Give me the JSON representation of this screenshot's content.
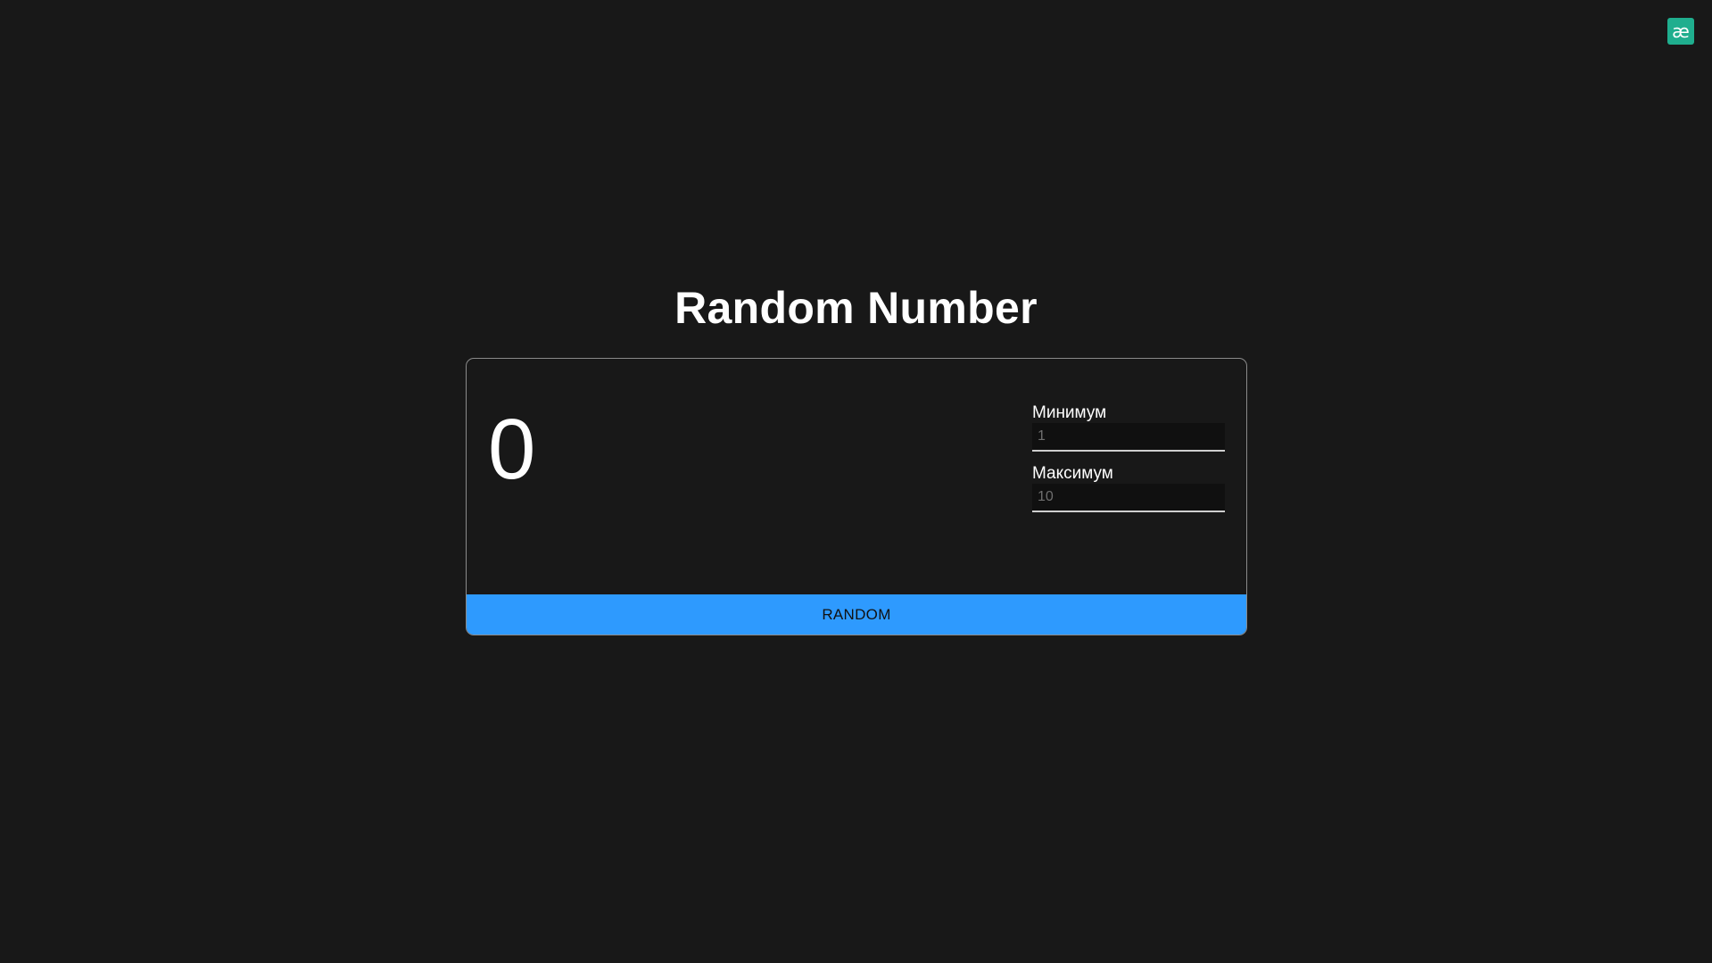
{
  "corner_badge": {
    "glyph": "æ",
    "icon": "ae-logo-icon",
    "color": "#1fae8e"
  },
  "title": "Random Number",
  "result": "0",
  "min": {
    "label": "Минимум",
    "placeholder": "1",
    "value": ""
  },
  "max": {
    "label": "Максимум",
    "placeholder": "10",
    "value": ""
  },
  "button": {
    "label": "RANDOM",
    "color": "#2e9afe"
  }
}
